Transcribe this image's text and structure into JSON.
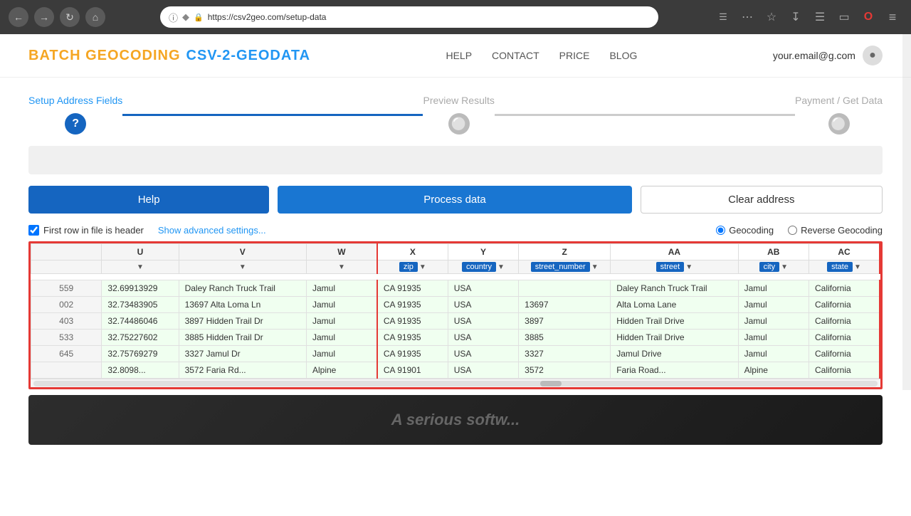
{
  "browser": {
    "url": "https://csv2geo.com/setup-data",
    "back_title": "back",
    "forward_title": "forward",
    "reload_title": "reload",
    "home_title": "home"
  },
  "header": {
    "logo_batch": "BATCH GEOCODING",
    "logo_csv": "CSV-2-GEODATA",
    "nav": {
      "help": "HELP",
      "contact": "CONTACT",
      "price": "PRICE",
      "blog": "BLOG"
    },
    "user_email": "your.email@g.com"
  },
  "steps": {
    "step1_label": "Setup Address Fields",
    "step2_label": "Preview Results",
    "step3_label": "Payment / Get Data"
  },
  "buttons": {
    "help": "Help",
    "process": "Process data",
    "clear": "Clear address"
  },
  "options": {
    "header_checkbox_label": "First row in file is header",
    "advanced_link": "Show advanced settings...",
    "geocoding_label": "Geocoding",
    "reverse_label": "Reverse Geocoding"
  },
  "columns": {
    "pre_cols": [
      "U",
      "V",
      "W"
    ],
    "highlighted_cols": [
      {
        "letter": "X",
        "badge": "zip"
      },
      {
        "letter": "Y",
        "badge": "country"
      },
      {
        "letter": "Z",
        "badge": "street_number"
      },
      {
        "letter": "AA",
        "badge": "street"
      },
      {
        "letter": "AB",
        "badge": "city"
      },
      {
        "letter": "AC",
        "badge": "state"
      }
    ]
  },
  "rows": [
    {
      "idx": "559",
      "u": "32.69913929",
      "v": "Daley Ranch Truck Trail",
      "w": "Jamul",
      "x": "CA 91935",
      "y": "USA",
      "z": "",
      "aa": "Daley Ranch Truck Trail",
      "ab": "Jamul",
      "ac": "California"
    },
    {
      "idx": "002",
      "u": "32.73483905",
      "v": "13697 Alta Loma Ln",
      "w": "Jamul",
      "x": "CA 91935",
      "y": "USA",
      "z": "13697",
      "aa": "Alta Loma Lane",
      "ab": "Jamul",
      "ac": "California"
    },
    {
      "idx": "403",
      "u": "32.74486046",
      "v": "3897 Hidden Trail Dr",
      "w": "Jamul",
      "x": "CA 91935",
      "y": "USA",
      "z": "3897",
      "aa": "Hidden Trail Drive",
      "ab": "Jamul",
      "ac": "California"
    },
    {
      "idx": "533",
      "u": "32.75227602",
      "v": "3885 Hidden Trail Dr",
      "w": "Jamul",
      "x": "CA 91935",
      "y": "USA",
      "z": "3885",
      "aa": "Hidden Trail Drive",
      "ab": "Jamul",
      "ac": "California"
    },
    {
      "idx": "645",
      "u": "32.75769279",
      "v": "3327 Jamul Dr",
      "w": "Jamul",
      "x": "CA 91935",
      "y": "USA",
      "z": "3327",
      "aa": "Jamul Drive",
      "ab": "Jamul",
      "ac": "California"
    },
    {
      "idx": "...",
      "u": "32.8098...",
      "v": "3572 Faria Rd...",
      "w": "Alpine",
      "x": "CA 91901",
      "y": "USA",
      "z": "3572",
      "aa": "Faria Road...",
      "ab": "Alpine",
      "ac": "California"
    }
  ],
  "footer_ad": {
    "text": "A serious software..."
  }
}
